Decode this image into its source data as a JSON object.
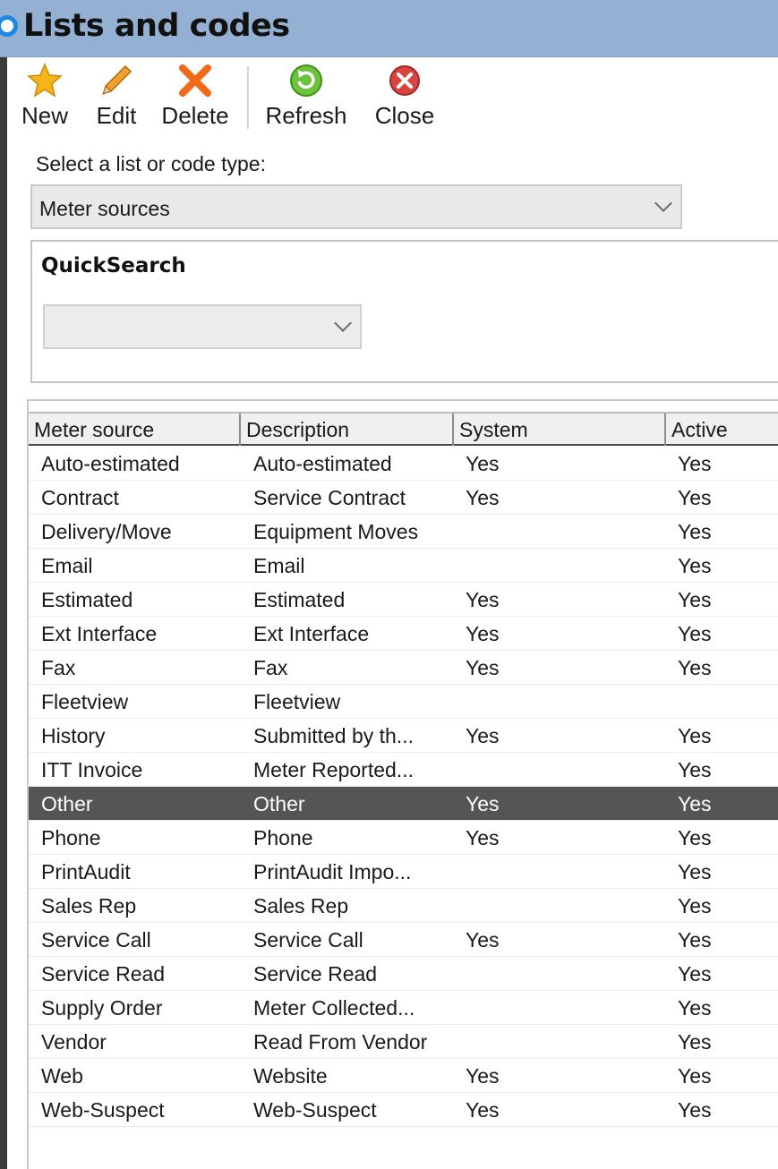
{
  "window": {
    "title": "Lists and codes"
  },
  "toolbar": {
    "new_label": "New",
    "edit_label": "Edit",
    "delete_label": "Delete",
    "refresh_label": "Refresh",
    "close_label": "Close"
  },
  "type_selector": {
    "label": "Select a list or code type:",
    "value": "Meter sources"
  },
  "quicksearch": {
    "title": "QuickSearch",
    "value": ""
  },
  "grid": {
    "columns": [
      "Meter source",
      "Description",
      "System",
      "Active"
    ],
    "selected_index": 10,
    "rows": [
      [
        "Auto-estimated",
        "Auto-estimated",
        "Yes",
        "Yes"
      ],
      [
        "Contract",
        "Service Contract",
        "Yes",
        "Yes"
      ],
      [
        "Delivery/Move",
        "Equipment Moves",
        "",
        "Yes"
      ],
      [
        "Email",
        "Email",
        "",
        "Yes"
      ],
      [
        "Estimated",
        "Estimated",
        "Yes",
        "Yes"
      ],
      [
        "Ext Interface",
        "Ext Interface",
        "Yes",
        "Yes"
      ],
      [
        "Fax",
        "Fax",
        "Yes",
        "Yes"
      ],
      [
        "Fleetview",
        "Fleetview",
        "",
        ""
      ],
      [
        "History",
        "Submitted by th...",
        "Yes",
        "Yes"
      ],
      [
        "ITT Invoice",
        "Meter Reported...",
        "",
        "Yes"
      ],
      [
        "Other",
        "Other",
        "Yes",
        "Yes"
      ],
      [
        "Phone",
        "Phone",
        "Yes",
        "Yes"
      ],
      [
        "PrintAudit",
        "PrintAudit Impo...",
        "",
        "Yes"
      ],
      [
        "Sales Rep",
        "Sales Rep",
        "",
        "Yes"
      ],
      [
        "Service Call",
        "Service Call",
        "Yes",
        "Yes"
      ],
      [
        "Service Read",
        "Service Read",
        "",
        "Yes"
      ],
      [
        "Supply Order",
        "Meter Collected...",
        "",
        "Yes"
      ],
      [
        "Vendor",
        "Read From Vendor",
        "",
        "Yes"
      ],
      [
        "Web",
        "Website",
        "Yes",
        "Yes"
      ],
      [
        "Web-Suspect",
        "Web-Suspect",
        "Yes",
        "Yes"
      ]
    ]
  },
  "icons": {
    "new": "star-icon",
    "edit": "pencil-icon",
    "delete": "red-x-icon",
    "refresh": "green-refresh-icon",
    "close": "red-circle-x-icon"
  },
  "colors": {
    "title_bar": "#94b0d2",
    "selected_row": "#555555",
    "accent_dot": "#1e88e5"
  }
}
